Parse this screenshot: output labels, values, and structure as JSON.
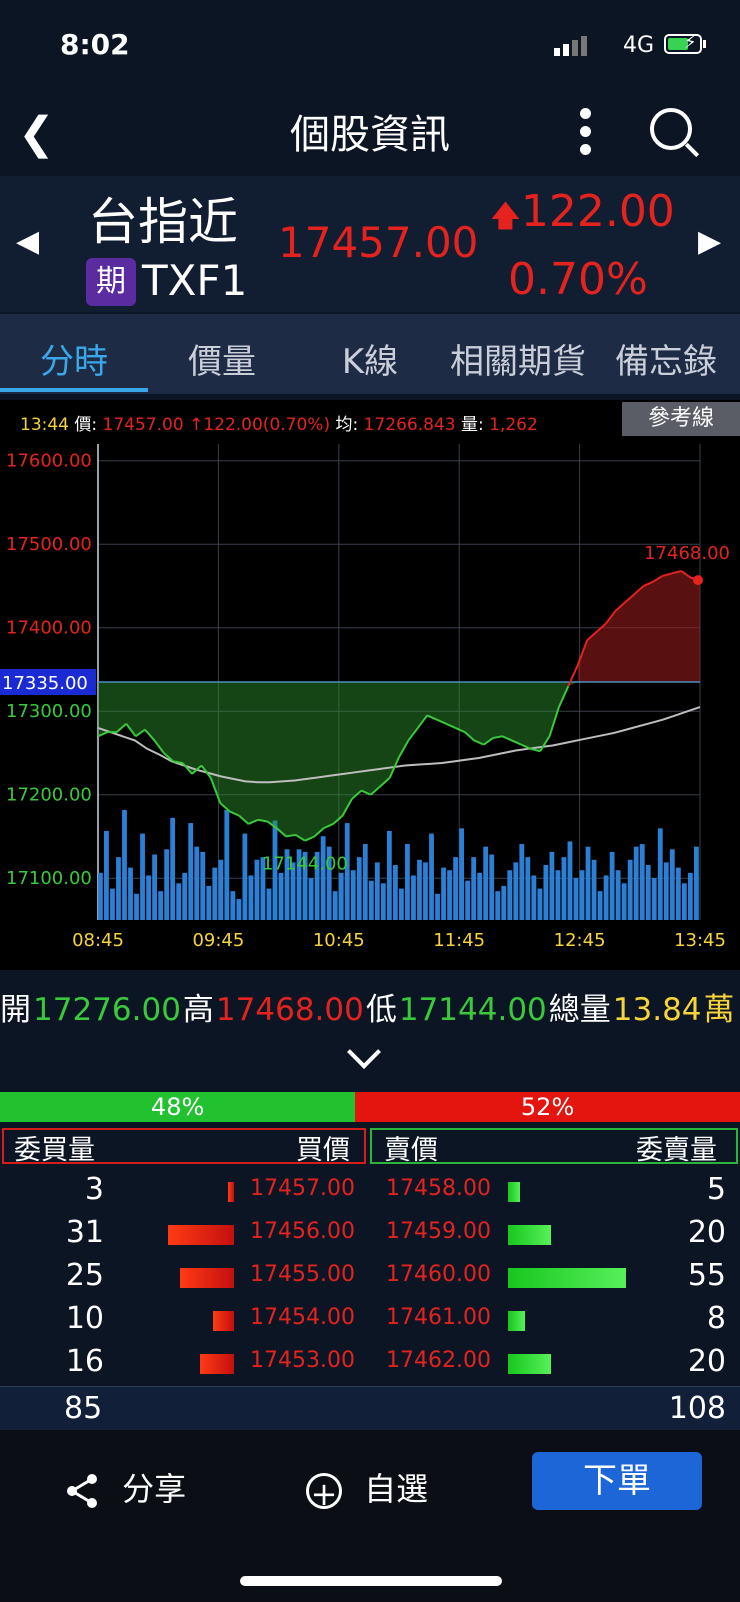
{
  "status": {
    "time": "8:02",
    "network": "4G"
  },
  "nav": {
    "title": "個股資訊"
  },
  "quote": {
    "name": "台指近",
    "badge": "期",
    "code": "TXF1",
    "price": "17457.00",
    "change": "122.00",
    "change_pct": "0.70%"
  },
  "tabs": [
    "分時",
    "價量",
    "K線",
    "相關期貨",
    "備忘錄"
  ],
  "info": {
    "time": "13:44",
    "price_label": "價:",
    "price": "17457.00",
    "change": "122.00(0.70%)",
    "avg_label": "均:",
    "avg": "17266.843",
    "vol_label": "量:",
    "vol": "1,262",
    "ref_button": "參考線"
  },
  "chart_data": {
    "type": "line",
    "y_ticks": [
      "17600.00",
      "17500.00",
      "17400.00",
      "17300.00",
      "17200.00",
      "17100.00"
    ],
    "x_ticks": [
      "08:45",
      "09:45",
      "10:45",
      "11:45",
      "12:45",
      "13:45"
    ],
    "ylim": [
      17050,
      17620
    ],
    "reference": {
      "value": 17335.0,
      "label": "17335.00"
    },
    "high_label": "17468.00",
    "low_label": "17144.00",
    "series": [
      {
        "values": [
          17270,
          17275,
          17275,
          17285,
          17270,
          17278,
          17265,
          17250,
          17240,
          17238,
          17225,
          17235,
          17220,
          17190,
          17180,
          17175,
          17165,
          17170,
          17168,
          17160,
          17150,
          17152,
          17145,
          17150,
          17160,
          17165,
          17175,
          17195,
          17205,
          17200,
          17210,
          17220,
          17245,
          17265,
          17280,
          17295,
          17290,
          17285,
          17280,
          17275,
          17265,
          17260,
          17268,
          17270,
          17265,
          17260,
          17255,
          17252,
          17270,
          17305,
          17330,
          17355,
          17385,
          17395,
          17405,
          17420,
          17430,
          17440,
          17450,
          17455,
          17462,
          17465,
          17468,
          17460,
          17457
        ]
      },
      {
        "values": [
          17280,
          17275,
          17270,
          17265,
          17255,
          17248,
          17240,
          17235,
          17230,
          17226,
          17222,
          17219,
          17216,
          17215,
          17215,
          17216,
          17217,
          17219,
          17221,
          17223,
          17225,
          17227,
          17229,
          17231,
          17233,
          17235,
          17236,
          17237,
          17238,
          17240,
          17242,
          17244,
          17247,
          17250,
          17253,
          17255,
          17257,
          17259,
          17262,
          17265,
          17268,
          17271,
          17274,
          17278,
          17282,
          17286,
          17290,
          17295,
          17300,
          17305
        ]
      }
    ],
    "volume": [
      18,
      34,
      12,
      24,
      42,
      20,
      10,
      33,
      17,
      25,
      11,
      27,
      39,
      14,
      18,
      37,
      28,
      26,
      13,
      20,
      23,
      42,
      11,
      8,
      33,
      17,
      23,
      24,
      12,
      38,
      18,
      27,
      22,
      27,
      26,
      16,
      26,
      32,
      28,
      11,
      18,
      37,
      19,
      24,
      29,
      15,
      22,
      14,
      34,
      21,
      12,
      29,
      17,
      23,
      22,
      33,
      10,
      20,
      19,
      24,
      35,
      15,
      24,
      18,
      28,
      25,
      11,
      13,
      19,
      22,
      29,
      24,
      17,
      12,
      21,
      26,
      19,
      24,
      30,
      16,
      19,
      28,
      23,
      11,
      17,
      26,
      19,
      14,
      23,
      28,
      29,
      21,
      16,
      35,
      22,
      27,
      20,
      14,
      18,
      28
    ]
  },
  "ohlc": {
    "open_label": "開",
    "open": "17276.00",
    "high_label": "高",
    "high": "17468.00",
    "low_label": "低",
    "low": "17144.00",
    "vol_label": "總量",
    "vol": "13.84",
    "vol_unit": "萬"
  },
  "ratio": {
    "buy": "48%",
    "sell": "52%",
    "buy_value": 0.48
  },
  "orderbook": {
    "headers": {
      "bid_qty": "委買量",
      "bid_price": "買價",
      "ask_price": "賣價",
      "ask_qty": "委賣量"
    },
    "rows": [
      {
        "bid_qty": "3",
        "bid": "17457.00",
        "ask": "17458.00",
        "ask_qty": "5",
        "bid_n": 3,
        "ask_n": 5
      },
      {
        "bid_qty": "31",
        "bid": "17456.00",
        "ask": "17459.00",
        "ask_qty": "20",
        "bid_n": 31,
        "ask_n": 20
      },
      {
        "bid_qty": "25",
        "bid": "17455.00",
        "ask": "17460.00",
        "ask_qty": "55",
        "bid_n": 25,
        "ask_n": 55
      },
      {
        "bid_qty": "10",
        "bid": "17454.00",
        "ask": "17461.00",
        "ask_qty": "8",
        "bid_n": 10,
        "ask_n": 8
      },
      {
        "bid_qty": "16",
        "bid": "17453.00",
        "ask": "17462.00",
        "ask_qty": "20",
        "bid_n": 16,
        "ask_n": 20
      }
    ],
    "total_bid": "85",
    "total_ask": "108"
  },
  "bottom": {
    "share": "分享",
    "fav": "自選",
    "order": "下單"
  },
  "colors": {
    "up": "#e5231e",
    "down": "#3ac93c",
    "accent": "#3aa8e8",
    "yellow": "#f5d33b"
  }
}
